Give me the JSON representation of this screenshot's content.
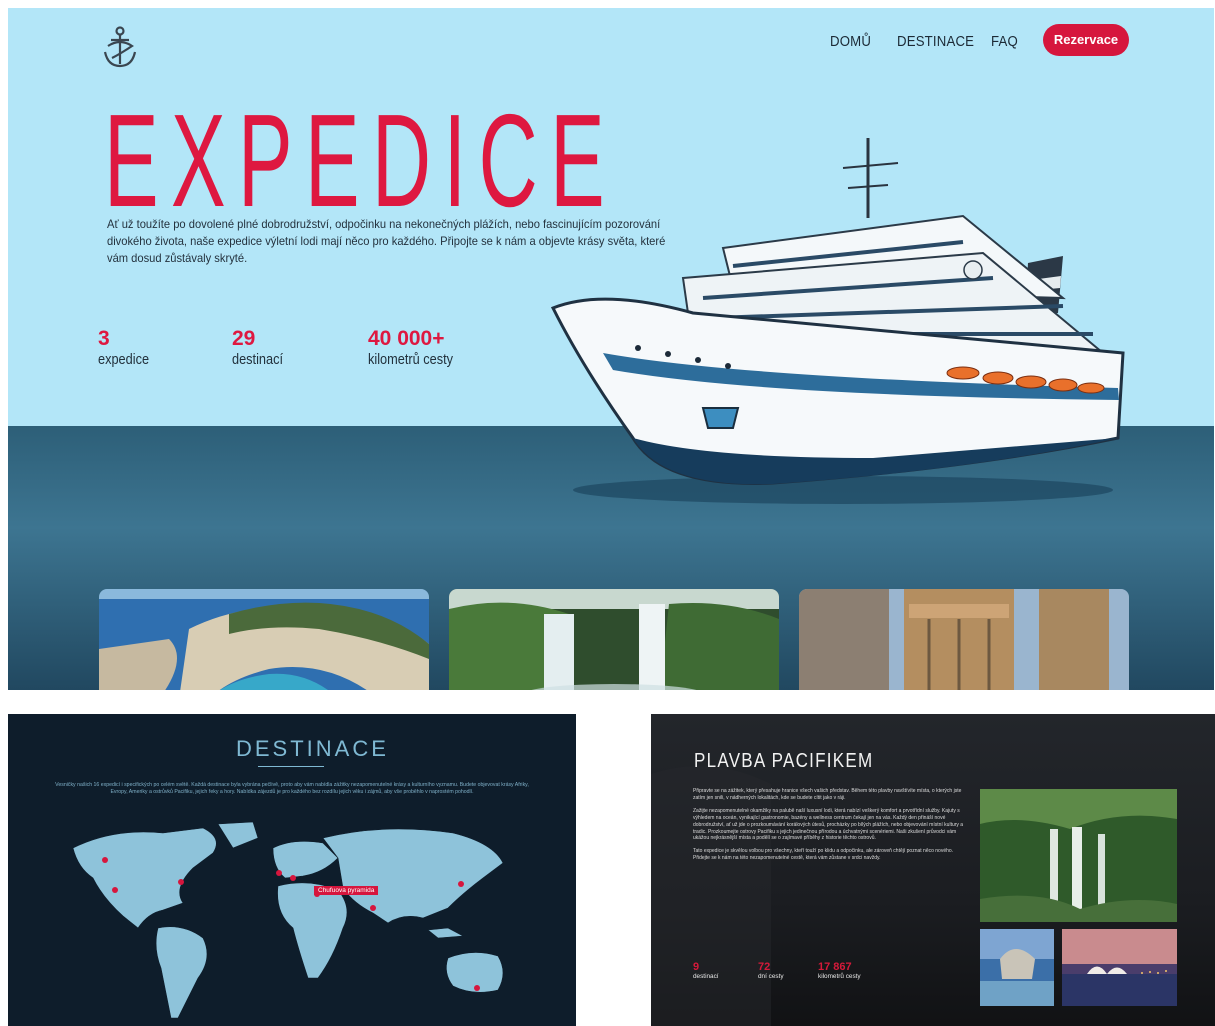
{
  "hero": {
    "logo_icon": "anchor-icon",
    "nav": {
      "links": [
        "DOMŮ",
        "DESTINACE",
        "FAQ"
      ],
      "cta_label": "Rezervace"
    },
    "title": "EXPEDICE",
    "intro": "Ať už toužíte po dovolené plné dobrodružství, odpočinku na nekonečných plážích, nebo fascinujícím pozorování divokého života, naše expedice výletní lodi mají něco pro každého. Připojte se k nám a objevte krásy světa, které vám dosud zůstávaly skryté.",
    "stats": [
      {
        "value": "3",
        "label": "expedice"
      },
      {
        "value": "29",
        "label": "destinací"
      },
      {
        "value": "40 000+",
        "label": "kilometrů cesty"
      }
    ],
    "cards": [
      "beach-cliff-photo",
      "waterfall-photo",
      "temple-columns-photo"
    ]
  },
  "destinations": {
    "title": "DESTINACE",
    "intro": "Vesničky našich 16 expedicí i specifických po celém světě. Každá destinace byla vybrána pečlivě, proto aby vám nabídla zážitky nezapomenutelné krásy a kulturního vyznamu. Budete objevovat krásy Afriky, Evropy, Ameriky a ostrůvků Pacifiku, jejich řeky a hory. Nabídka zájezdů je pro každého bez rozdílu jejich věku i zájmů, aby vše proběhlo v naprostém pohodlí.",
    "map_label": "Chufuova pyramida"
  },
  "pacific": {
    "title": "PLAVBA PACIFIKEM",
    "paragraphs": [
      "Připravte se na zážitek, který přesahuje hranice všech vašich představ. Během této plavby navštívíte místa, o kterých jste zatím jen snili, v nádherných lokalitách, kde se budete cítit jako v ráji.",
      "Zažijte nezapomenutelné okamžiky na palubě naší luxusní lodi, která nabízí veškerý komfort a prvotřídní služby. Kajuty s výhledem na oceán, vynikající gastronomie, bazény a wellness centrum čekají jen na vás. Každý den přináší nové dobrodružství, ať už jde o prozkoumávání korálových útesů, procházky po bílých plážích, nebo objevování místní kultury a tradic. Prozkoumejte ostrovy Pacifiku s jejich jedinečnou přírodou a úchvatnými scenériemi. Naši zkušení průvodci vám ukážou nejkrásnější místa a podělí se o zajímavé příběhy z historie těchto ostrovů.",
      "Tato expedice je skvělou volbou pro všechny, kteří touží po klidu a odpočinku, ale zároveň chtějí poznat něco nového. Přidejte se k nám na této nezapomenutelné cestě, která vám zůstane v srdci navždy."
    ],
    "stats": [
      {
        "value": "9",
        "label": "destinací"
      },
      {
        "value": "72",
        "label": "dní cesty"
      },
      {
        "value": "17 867",
        "label": "kilometrů cesty"
      }
    ]
  }
}
